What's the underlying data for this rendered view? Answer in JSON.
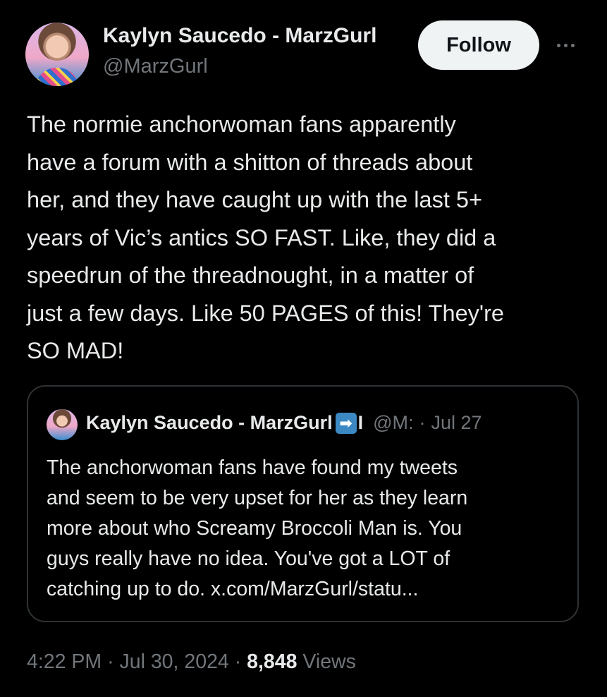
{
  "author": {
    "display_name": "Kaylyn Saucedo - MarzGurl",
    "handle": "@MarzGurl",
    "follow_label": "Follow",
    "more_icon": "more-icon"
  },
  "tweet": {
    "lines": [
      "The normie anchorwoman fans apparently",
      "have a forum with a shitton of threads about",
      "her, and they have caught up with the last 5+",
      "years of Vic’s antics SO FAST. Like, they did a",
      "speedrun of the threadnought, in a matter of",
      "just a few days. Like 50 PAGES of this! They're",
      "SO MAD!"
    ]
  },
  "quote": {
    "display_name": "Kaylyn Saucedo - MarzGurl",
    "badge_icon": "➡",
    "truncated_char": "I",
    "handle": "@M:",
    "separator": "·",
    "date": "Jul 27",
    "lines": [
      "The anchorwoman fans have found my tweets",
      "and seem to be very upset for her as they learn",
      "more about who Screamy Broccoli Man is. You",
      "guys really have no idea. You've got a LOT of",
      "catching up to do. x.com/MarzGurl/statu..."
    ]
  },
  "meta": {
    "time": "4:22 PM",
    "sep1": "·",
    "date": "Jul 30, 2024",
    "sep2": "·",
    "views_count": "8,848",
    "views_label": "Views"
  }
}
